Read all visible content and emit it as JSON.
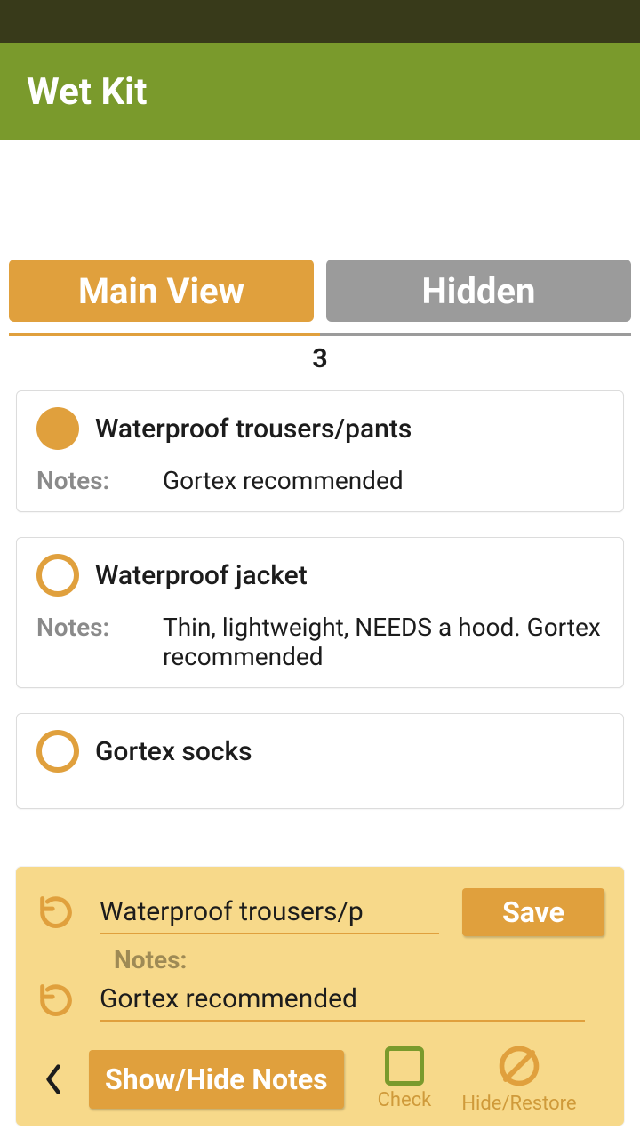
{
  "colors": {
    "accent": "#e0a03d",
    "header": "#7a9a2c",
    "statusbar": "#383a1a",
    "editor_bg": "#f7d98a"
  },
  "appbar": {
    "title": "Wet Kit"
  },
  "tabs": {
    "main": {
      "label": "Main View",
      "active": true
    },
    "hidden": {
      "label": "Hidden",
      "active": false
    }
  },
  "count": "3",
  "notes_label": "Notes:",
  "items": [
    {
      "checked": true,
      "title": "Waterproof trousers/pants",
      "notes": "Gortex recommended"
    },
    {
      "checked": false,
      "title": "Waterproof jacket",
      "notes": "Thin, lightweight, NEEDS a hood. Gortex recommended"
    },
    {
      "checked": false,
      "title": "Gortex socks",
      "notes": ""
    }
  ],
  "editor": {
    "title_value": "Waterproof trousers/p",
    "notes_value": "Gortex recommended",
    "save_label": "Save",
    "notes_label": "Notes:",
    "toggle_notes_label": "Show/Hide Notes",
    "check_label": "Check",
    "hide_label": "Hide/Restore"
  }
}
